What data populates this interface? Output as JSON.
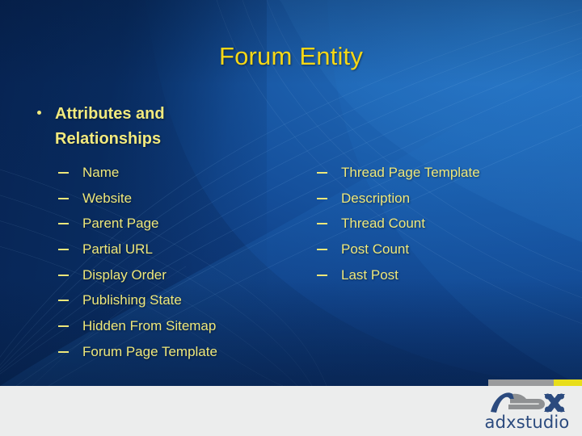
{
  "slide": {
    "title": "Forum Entity",
    "heading": {
      "bullet_glyph": "bullet-dot",
      "text": "Attributes and Relationships"
    },
    "columns": {
      "left": [
        {
          "marker": "en-dash",
          "label": "Name"
        },
        {
          "marker": "en-dash",
          "label": "Website"
        },
        {
          "marker": "en-dash",
          "label": "Parent Page"
        },
        {
          "marker": "en-dash",
          "label": "Partial URL"
        },
        {
          "marker": "en-dash",
          "label": "Display Order"
        },
        {
          "marker": "en-dash",
          "label": "Publishing State"
        },
        {
          "marker": "en-dash",
          "label": "Hidden From Sitemap"
        },
        {
          "marker": "en-dash",
          "label": "Forum Page Template"
        }
      ],
      "right": [
        {
          "marker": "en-dash",
          "label": "Thread Page Template"
        },
        {
          "marker": "en-dash",
          "label": "Description"
        },
        {
          "marker": "en-dash",
          "label": "Thread Count"
        },
        {
          "marker": "en-dash",
          "label": "Post Count"
        },
        {
          "marker": "en-dash",
          "label": "Last Post"
        }
      ]
    }
  },
  "footer": {
    "logo": {
      "wordmark": "adxstudio",
      "mark_name": "adx-logo-mark"
    }
  },
  "colors": {
    "title_yellow": "#f5d716",
    "body_yellow": "#eee77a",
    "heading_yellow": "#f2ea7e",
    "bg_blue_light": "#2574c4",
    "bg_blue_dark": "#05204c",
    "footer_gray": "#eceded",
    "accent_gray": "#9a9b9d",
    "accent_yellow": "#e8de1b",
    "logo_navy": "#2b4a7e",
    "logo_gray": "#8f9193"
  }
}
